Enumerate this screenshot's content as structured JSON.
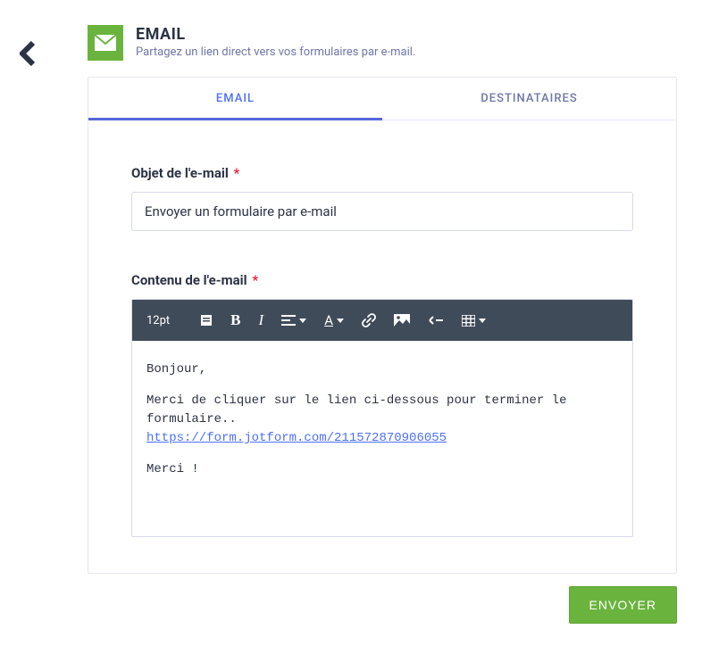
{
  "header": {
    "title": "EMAIL",
    "subtitle": "Partagez un lien direct vers vos formulaires par e-mail."
  },
  "tabs": {
    "email": "EMAIL",
    "recipients": "DESTINATAIRES"
  },
  "subject": {
    "label": "Objet de l'e-mail",
    "value": "Envoyer un formulaire par e-mail"
  },
  "content": {
    "label": "Contenu de l'e-mail",
    "greeting": "Bonjour,",
    "body_line": "Merci de cliquer sur le lien ci-dessous pour terminer le formulaire..",
    "link": "https://form.jotform.com/211572870906055",
    "closing": "Merci !"
  },
  "toolbar": {
    "fontsize": "12pt"
  },
  "send_button": "ENVOYER"
}
